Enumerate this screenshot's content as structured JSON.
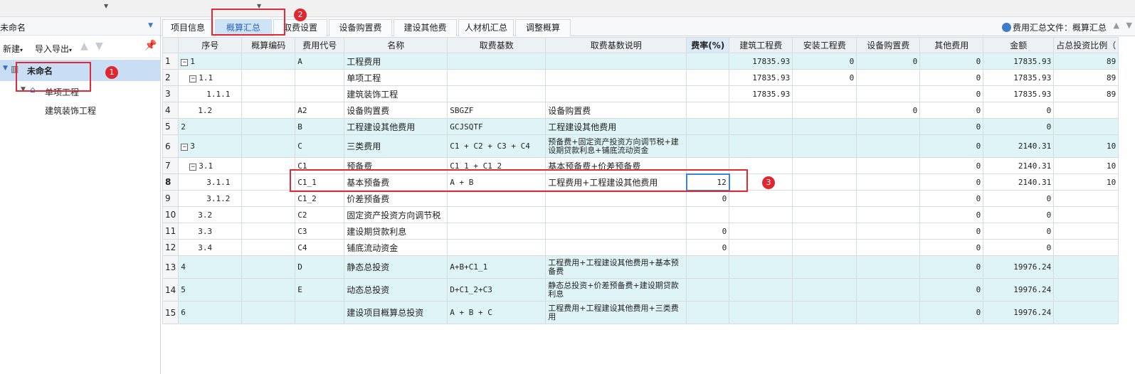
{
  "left": {
    "project_name": "未命名",
    "toolbar": {
      "new_label": "新建",
      "import_export_label": "导入导出"
    },
    "tree": [
      {
        "label": "未命名"
      },
      {
        "label": "单项工程"
      },
      {
        "label": "建筑装饰工程"
      }
    ]
  },
  "tabs": [
    {
      "label": "项目信息"
    },
    {
      "label": "概算汇总"
    },
    {
      "label": "取费设置"
    },
    {
      "label": "设备购置费"
    },
    {
      "label": "建设其他费"
    },
    {
      "label": "人材机汇总"
    },
    {
      "label": "调整概算"
    }
  ],
  "active_tab": "概算汇总",
  "summary_file_label": "费用汇总文件：概算汇总",
  "columns": [
    "序号",
    "概算编码",
    "费用代号",
    "名称",
    "取费基数",
    "取费基数说明",
    "费率(%)",
    "建筑工程费",
    "安装工程费",
    "设备购置费",
    "其他费用",
    "金额",
    "占总投资比例（"
  ],
  "rows": [
    {
      "rn": "1",
      "seq": "1",
      "code": "",
      "fcode": "A",
      "name": "工程费用",
      "base": "",
      "desc": "",
      "rate": "",
      "build": "17835.93",
      "install": "0",
      "equip": "0",
      "other": "0",
      "amount": "17835.93",
      "ratio": "89"
    },
    {
      "rn": "2",
      "seq": "1.1",
      "code": "",
      "fcode": "",
      "name": "单项工程",
      "base": "",
      "desc": "",
      "rate": "",
      "build": "17835.93",
      "install": "0",
      "equip": "",
      "other": "0",
      "amount": "17835.93",
      "ratio": "89"
    },
    {
      "rn": "3",
      "seq": "1.1.1",
      "code": "",
      "fcode": "",
      "name": "建筑装饰工程",
      "base": "",
      "desc": "",
      "rate": "",
      "build": "17835.93",
      "install": "",
      "equip": "",
      "other": "0",
      "amount": "17835.93",
      "ratio": "89"
    },
    {
      "rn": "4",
      "seq": "1.2",
      "code": "",
      "fcode": "A2",
      "name": "设备购置费",
      "base": "SBGZF",
      "desc": "设备购置费",
      "rate": "",
      "build": "",
      "install": "",
      "equip": "0",
      "other": "0",
      "amount": "0",
      "ratio": ""
    },
    {
      "rn": "5",
      "seq": "2",
      "code": "",
      "fcode": "B",
      "name": "工程建设其他费用",
      "base": "GCJSQTF",
      "desc": "工程建设其他费用",
      "rate": "",
      "build": "",
      "install": "",
      "equip": "",
      "other": "0",
      "amount": "0",
      "ratio": ""
    },
    {
      "rn": "6",
      "seq": "3",
      "code": "",
      "fcode": "C",
      "name": "三类费用",
      "base": "C1 + C2 + C3 + C4",
      "desc": "预备费+固定资产投资方向调节税+建设期贷款利息+铺底流动资金",
      "rate": "",
      "build": "",
      "install": "",
      "equip": "",
      "other": "0",
      "amount": "2140.31",
      "ratio": "10"
    },
    {
      "rn": "7",
      "seq": "3.1",
      "code": "",
      "fcode": "C1",
      "name": "预备费",
      "base": "C1_1 + C1_2",
      "desc": "基本预备费+价差预备费",
      "rate": "",
      "build": "",
      "install": "",
      "equip": "",
      "other": "0",
      "amount": "2140.31",
      "ratio": "10"
    },
    {
      "rn": "8",
      "seq": "3.1.1",
      "code": "",
      "fcode": "C1_1",
      "name": "基本预备费",
      "base": "A + B",
      "desc": "工程费用+工程建设其他费用",
      "rate": "12",
      "build": "",
      "install": "",
      "equip": "",
      "other": "0",
      "amount": "2140.31",
      "ratio": "10"
    },
    {
      "rn": "9",
      "seq": "3.1.2",
      "code": "",
      "fcode": "C1_2",
      "name": "价差预备费",
      "base": "",
      "desc": "",
      "rate": "0",
      "build": "",
      "install": "",
      "equip": "",
      "other": "0",
      "amount": "0",
      "ratio": ""
    },
    {
      "rn": "10",
      "seq": "3.2",
      "code": "",
      "fcode": "C2",
      "name": "固定资产投资方向调节税",
      "base": "",
      "desc": "",
      "rate": "",
      "build": "",
      "install": "",
      "equip": "",
      "other": "0",
      "amount": "0",
      "ratio": ""
    },
    {
      "rn": "11",
      "seq": "3.3",
      "code": "",
      "fcode": "C3",
      "name": "建设期贷款利息",
      "base": "",
      "desc": "",
      "rate": "0",
      "build": "",
      "install": "",
      "equip": "",
      "other": "0",
      "amount": "0",
      "ratio": ""
    },
    {
      "rn": "12",
      "seq": "3.4",
      "code": "",
      "fcode": "C4",
      "name": "铺底流动资金",
      "base": "",
      "desc": "",
      "rate": "0",
      "build": "",
      "install": "",
      "equip": "",
      "other": "0",
      "amount": "0",
      "ratio": ""
    },
    {
      "rn": "13",
      "seq": "4",
      "code": "",
      "fcode": "D",
      "name": "静态总投资",
      "base": "A+B+C1_1",
      "desc": "工程费用+工程建设其他费用+基本预备费",
      "rate": "",
      "build": "",
      "install": "",
      "equip": "",
      "other": "0",
      "amount": "19976.24",
      "ratio": ""
    },
    {
      "rn": "14",
      "seq": "5",
      "code": "",
      "fcode": "E",
      "name": "动态总投资",
      "base": "D+C1_2+C3",
      "desc": "静态总投资+价差预备费+建设期贷款利息",
      "rate": "",
      "build": "",
      "install": "",
      "equip": "",
      "other": "0",
      "amount": "19976.24",
      "ratio": ""
    },
    {
      "rn": "15",
      "seq": "6",
      "code": "",
      "fcode": "",
      "name": "建设项目概算总投资",
      "base": "A + B + C",
      "desc": "工程费用+工程建设其他费用+三类费用",
      "rate": "",
      "build": "",
      "install": "",
      "equip": "",
      "other": "0",
      "amount": "19976.24",
      "ratio": ""
    }
  ],
  "annotations": [
    "1",
    "2",
    "3"
  ],
  "colors": {
    "selected_tab": "#cfe3f7",
    "teal_row": "#dff4f6",
    "annotation_red": "#e0262f",
    "accent_blue": "#3a86d6"
  }
}
